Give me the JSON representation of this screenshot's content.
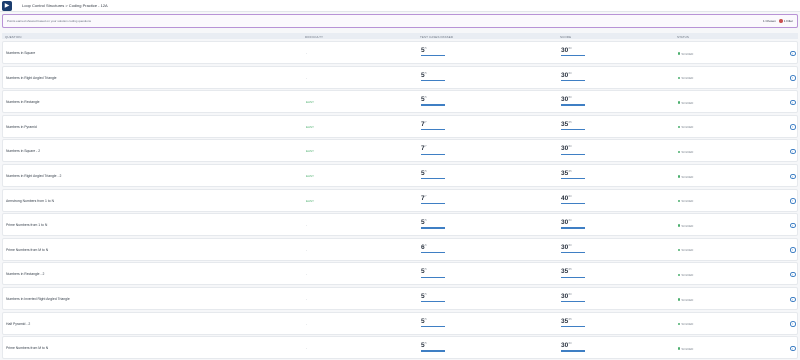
{
  "header": {
    "logo_glyph": "▶",
    "breadcrumb": "Loop Control Structures > Coding Practice - 12A"
  },
  "notice": {
    "message": "Points earned showed based on your solution coding questions",
    "selected_count": "1 Chosen",
    "filter_label": "1 Filter"
  },
  "table": {
    "columns": {
      "question": "QUESTION",
      "difficulty": "DIFFICULTY",
      "test_cases": "TEST CASES PASSED",
      "score": "SCORE",
      "status": "STATUS"
    },
    "rows": [
      {
        "name": "Numbers in Square",
        "difficulty": "-",
        "diff_class": "none",
        "tests": "5",
        "tests_total": "/5",
        "tests_chip": "Latest Attempt: 5/5",
        "tests_fill": 1.0,
        "score": "30",
        "score_total": "/30",
        "score_chip": "Latest Score: 30/30",
        "score_fill": 1.0,
        "status": "SOLVED"
      },
      {
        "name": "Numbers in Right Angled Triangle",
        "difficulty": "-",
        "diff_class": "none",
        "tests": "5",
        "tests_total": "/5",
        "tests_chip": "Latest Attempt: 5/5",
        "tests_fill": 1.0,
        "score": "30",
        "score_total": "/30",
        "score_chip": "Latest Score: 30/30",
        "score_fill": 1.0,
        "status": "SOLVED"
      },
      {
        "name": "Numbers in Rectangle",
        "difficulty": "EASY",
        "diff_class": "easy",
        "tests": "5",
        "tests_total": "/5",
        "tests_chip": "Latest Attempt: 5/5",
        "tests_fill": 1.0,
        "score": "30",
        "score_total": "/30",
        "score_chip": "Latest Score: 30/30",
        "score_fill": 1.0,
        "status": "SOLVED"
      },
      {
        "name": "Numbers in Pyramid",
        "difficulty": "EASY",
        "diff_class": "easy",
        "tests": "7",
        "tests_total": "/7",
        "tests_chip": "Latest Attempt: 7/7",
        "tests_fill": 1.0,
        "score": "35",
        "score_total": "/35",
        "score_chip": "Latest Score: 35/35",
        "score_fill": 1.0,
        "status": "SOLVED"
      },
      {
        "name": "Numbers in Square - 2",
        "difficulty": "EASY",
        "diff_class": "easy",
        "tests": "7",
        "tests_total": "/7",
        "tests_chip": "Latest Attempt: 7/7",
        "tests_fill": 1.0,
        "score": "30",
        "score_total": "/30",
        "score_chip": "Latest Score: 30/30",
        "score_fill": 1.0,
        "status": "SOLVED"
      },
      {
        "name": "Numbers in Right Angled Triangle - 2",
        "difficulty": "EASY",
        "diff_class": "easy",
        "tests": "5",
        "tests_total": "/5",
        "tests_chip": "Latest Attempt: 5/5",
        "tests_fill": 1.0,
        "score": "35",
        "score_total": "/35",
        "score_chip": "Latest Score: 35/35",
        "score_fill": 1.0,
        "status": "SOLVED"
      },
      {
        "name": "Armstrong Numbers from 1 to N",
        "difficulty": "EASY",
        "diff_class": "easy",
        "tests": "7",
        "tests_total": "/7",
        "tests_chip": "Latest Attempt: 7/7",
        "tests_fill": 1.0,
        "score": "40",
        "score_total": "/40",
        "score_chip": "Latest Score: 40/40",
        "score_fill": 1.0,
        "status": "SOLVED"
      },
      {
        "name": "Prime Numbers from 1 to N",
        "difficulty": "-",
        "diff_class": "none",
        "tests": "5",
        "tests_total": "/5",
        "tests_chip": "Latest Attempt: 5/5",
        "tests_fill": 1.0,
        "score": "30",
        "score_total": "/30",
        "score_chip": "Latest Score: 30/30",
        "score_fill": 1.0,
        "status": "SOLVED"
      },
      {
        "name": "Prime Numbers from M to N",
        "difficulty": "-",
        "diff_class": "none",
        "tests": "6",
        "tests_total": "/6",
        "tests_chip": "Latest Attempt: 6/6",
        "tests_fill": 1.0,
        "score": "30",
        "score_total": "/30",
        "score_chip": "Latest Score: 30/30",
        "score_fill": 1.0,
        "status": "SOLVED"
      },
      {
        "name": "Numbers in Rectangle - 2",
        "difficulty": "-",
        "diff_class": "none",
        "tests": "5",
        "tests_total": "/5",
        "tests_chip": "Latest Attempt: 5/5",
        "tests_fill": 1.0,
        "score": "35",
        "score_total": "/35",
        "score_chip": "Latest Score: 35/35",
        "score_fill": 1.0,
        "status": "SOLVED"
      },
      {
        "name": "Numbers in Inverted Right Angled Triangle",
        "difficulty": "-",
        "diff_class": "none",
        "tests": "5",
        "tests_total": "/5",
        "tests_chip": "Latest Attempt: 5/5",
        "tests_fill": 1.0,
        "score": "30",
        "score_total": "/30",
        "score_chip": "Latest Score: 30/30",
        "score_fill": 1.0,
        "status": "SOLVED"
      },
      {
        "name": "Half Pyramid - 2",
        "difficulty": "-",
        "diff_class": "none",
        "tests": "5",
        "tests_total": "/5",
        "tests_chip": "Latest Attempt: 5/5",
        "tests_fill": 1.0,
        "score": "35",
        "score_total": "/35",
        "score_chip": "Latest Score: 35/35",
        "score_fill": 1.0,
        "status": "SOLVED"
      },
      {
        "name": "Prime Numbers from M to N",
        "difficulty": "-",
        "diff_class": "none",
        "tests": "5",
        "tests_total": "/5",
        "tests_chip": "Latest Attempt: 5/5",
        "tests_fill": 1.0,
        "score": "30",
        "score_total": "/30",
        "score_chip": "Latest Score: 30/30",
        "score_fill": 1.0,
        "status": "SOLVED"
      }
    ]
  },
  "icons": {
    "go": "arrow-right-icon",
    "status": "check-dot-icon",
    "filter": "filter-icon"
  },
  "colors": {
    "accent": "#3f7fc4",
    "easy": "#4caf6e",
    "notice_border": "#b893d6"
  }
}
